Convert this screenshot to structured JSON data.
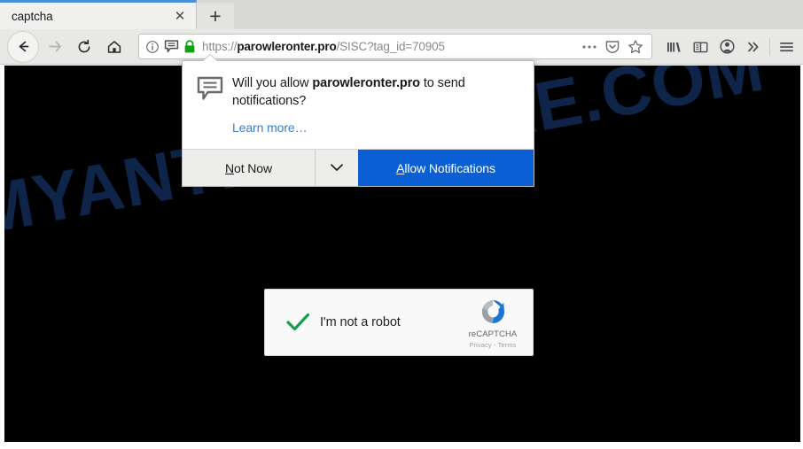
{
  "browser": {
    "tab": {
      "title": "captcha",
      "close_label": "✕",
      "newtab_label": "+"
    },
    "nav": {
      "back_icon": "back-arrow-icon",
      "forward_icon": "forward-arrow-icon",
      "reload_icon": "reload-icon",
      "home_icon": "home-icon"
    },
    "urlbar": {
      "info_icon": "page-info-icon",
      "notification_icon": "notification-bubble-icon",
      "lock_icon": "padlock-icon",
      "scheme": "https://",
      "host": "parowleronter.pro",
      "path": "/SISC?tag_id=70905",
      "full_url": "https://parowleronter.pro/SISC?tag_id=70905",
      "ellipsis_icon": "page-actions-icon",
      "pocket_icon": "save-to-pocket-icon",
      "bookmark_icon": "bookmark-star-icon"
    },
    "toolbar_right": {
      "library_icon": "library-icon",
      "sidebar_icon": "sidebar-icon",
      "account_icon": "account-avatar-icon",
      "overflow_icon": "chevron-double-right-icon",
      "menu_icon": "hamburger-menu-icon"
    }
  },
  "notification_popup": {
    "icon": "notification-bubble-icon",
    "question_prefix": "Will you allow ",
    "question_host": "parowleronter.pro",
    "question_suffix": " to send notifications?",
    "learn_more": "Learn more…",
    "not_now_accel": "N",
    "not_now_rest": "ot Now",
    "dropdown_icon": "chevron-down-icon",
    "allow_accel": "A",
    "allow_rest": "llow Notifications",
    "accent_color": "#0a5fd4"
  },
  "page": {
    "background_color": "#000000",
    "watermark_text": "MYANTISPYWARE.COM",
    "watermark_color": "#0e2449"
  },
  "recaptcha": {
    "checkbox_label": "I'm not a robot",
    "check_icon": "green-checkmark-icon",
    "logo_icon": "recaptcha-logo-icon",
    "brand_text": "reCAPTCHA",
    "privacy_label": "Privacy",
    "separator": "-",
    "terms_label": "Terms",
    "legal_text": "Privacy - Terms"
  }
}
